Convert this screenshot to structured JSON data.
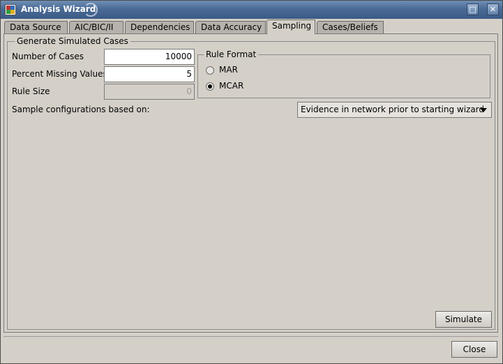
{
  "window": {
    "title": "Analysis Wizard",
    "controls": {
      "restore": "□",
      "close": "✕"
    }
  },
  "tabs": [
    {
      "label": "Data Source",
      "active": false
    },
    {
      "label": "AIC/BIC/II",
      "active": false
    },
    {
      "label": "Dependencies",
      "active": false
    },
    {
      "label": "Data Accuracy",
      "active": false
    },
    {
      "label": "Sampling",
      "active": true
    },
    {
      "label": "Cases/Beliefs",
      "active": false
    }
  ],
  "generate": {
    "legend": "Generate Simulated Cases",
    "number_of_cases_label": "Number of Cases",
    "number_of_cases_value": "10000",
    "percent_missing_label": "Percent Missing Values",
    "percent_missing_value": "5",
    "rule_size_label": "Rule Size",
    "rule_size_value": "0"
  },
  "rule_format": {
    "legend": "Rule Format",
    "options": [
      {
        "label": "MAR",
        "selected": false
      },
      {
        "label": "MCAR",
        "selected": true
      }
    ]
  },
  "sample_config": {
    "label": "Sample configurations based on:",
    "selected": "Evidence in network prior to starting wizard"
  },
  "buttons": {
    "simulate": "Simulate",
    "close": "Close"
  }
}
